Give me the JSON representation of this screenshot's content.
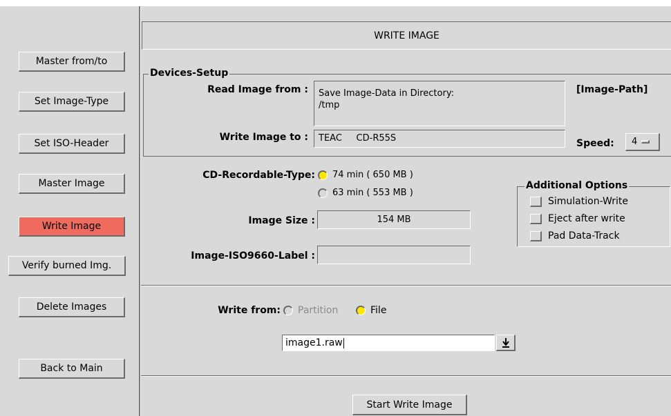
{
  "sidebar": {
    "items": [
      {
        "label": "Master from/to"
      },
      {
        "label": "Set Image-Type"
      },
      {
        "label": "Set ISO-Header"
      },
      {
        "label": "Master Image"
      },
      {
        "label": "Write Image",
        "active": true
      },
      {
        "label": "Verify burned Img."
      },
      {
        "label": "Delete Images"
      },
      {
        "label": "Back to Main"
      }
    ]
  },
  "header": {
    "title": "WRITE IMAGE"
  },
  "devices": {
    "legend": "Devices-Setup",
    "read_label": "Read Image from :",
    "read_line1": "Save Image-Data in Directory:",
    "read_line2": "/tmp",
    "image_path": "[Image-Path]",
    "write_label": "Write Image to :",
    "write_device": "TEAC     CD-R55S",
    "speed_label": "Speed:",
    "speed_value": "4",
    "speed_icon": "option-menu-indicator-icon"
  },
  "cd_type": {
    "label": "CD-Recordable-Type:",
    "options": [
      {
        "label": "74 min ( 650 MB )",
        "selected": true
      },
      {
        "label": "63 min ( 553 MB )",
        "selected": false
      }
    ]
  },
  "image_size": {
    "label": "Image Size :",
    "value": "154 MB"
  },
  "iso_label": {
    "label": "Image-ISO9660-Label :",
    "value": ""
  },
  "additional": {
    "legend": "Additional Options",
    "options": [
      {
        "label": "Simulation-Write",
        "checked": false
      },
      {
        "label": "Eject after write",
        "checked": false
      },
      {
        "label": "Pad Data-Track",
        "checked": false
      }
    ]
  },
  "write_from": {
    "label": "Write from:",
    "options": [
      {
        "label": "Partition",
        "selected": false
      },
      {
        "label": "File",
        "selected": true
      }
    ]
  },
  "file_entry": {
    "value": "image1.raw",
    "dropdown_icon": "download-arrow-icon"
  },
  "actions": {
    "start_label": "Start Write Image"
  },
  "colors": {
    "active_button": "#ef6b5f",
    "radio_selected": "#ffe600",
    "background": "#d9d9d9"
  }
}
